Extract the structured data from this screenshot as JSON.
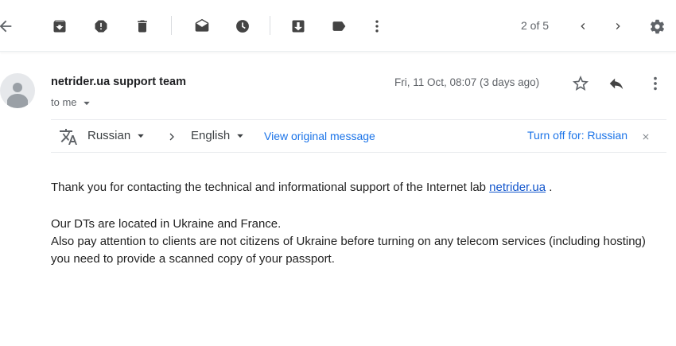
{
  "toolbar": {
    "counter": "2 of 5"
  },
  "message": {
    "sender": "netrider.ua support team",
    "recipient_label": "to me",
    "date": "Fri, 11 Oct, 08:07 (3 days ago)"
  },
  "translate": {
    "from_lang": "Russian",
    "to_lang": "English",
    "view_original": "View original message",
    "turn_off": "Turn off for: Russian"
  },
  "body": {
    "line1_pre": "Thank you for contacting the technical and informational support of the Internet lab ",
    "line1_link": "netrider.ua",
    "line1_post": " .",
    "line2": "Our DTs are located in Ukraine and France.",
    "line3": "Also pay attention to clients are not citizens of Ukraine before turning on any telecom services (including hosting)",
    "line4": "you need to provide a scanned copy of your passport."
  }
}
